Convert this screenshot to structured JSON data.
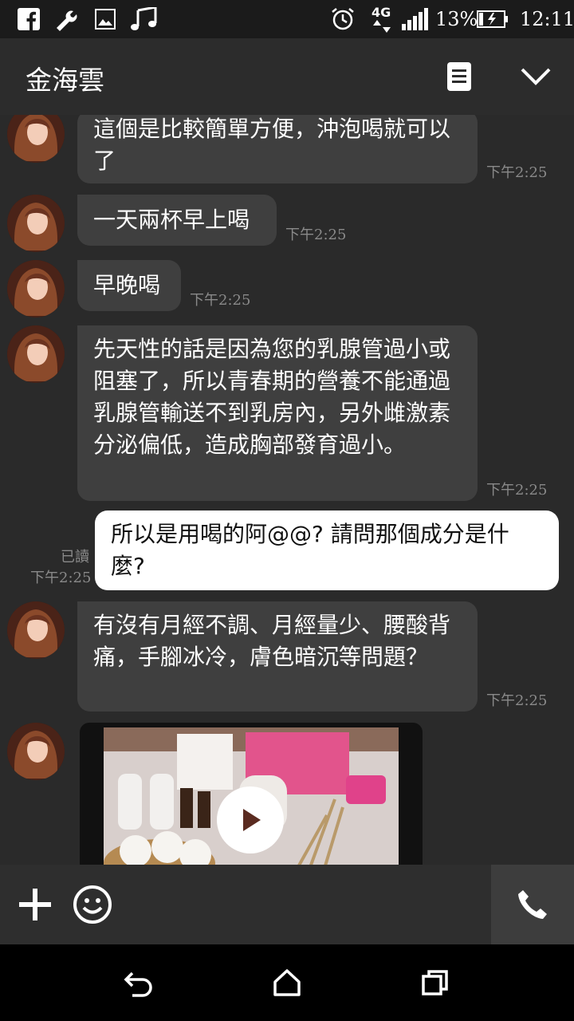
{
  "status_bar": {
    "network": "4G",
    "battery": "13%",
    "time": "12:11",
    "icons": [
      "facebook-icon",
      "wrench-icon",
      "image-icon",
      "music-icon",
      "alarm-icon",
      "signal-icon",
      "battery-icon"
    ]
  },
  "header": {
    "contact_name": "金海雲",
    "menu_icon": "notes-icon",
    "collapse_icon": "chevron-down-icon"
  },
  "messages": [
    {
      "from": "contact",
      "text": "這個是比較簡單方便，沖泡喝就可以了",
      "time": "下午2:25"
    },
    {
      "from": "contact",
      "text": "一天兩杯早上喝",
      "time": "下午2:25"
    },
    {
      "from": "contact",
      "text": "早晚喝",
      "time": "下午2:25"
    },
    {
      "from": "contact",
      "text": "先天性的話是因為您的乳腺管過小或阻塞了，所以青春期的營養不能通過乳腺管輸送不到乳房內，另外雌激素分泌偏低，造成胸部發育過小。",
      "time": "下午2:25"
    },
    {
      "from": "me",
      "text": "所以是用喝的阿@@? 請問那個成分是什麼?",
      "read": "已讀",
      "time": "下午2:25"
    },
    {
      "from": "contact",
      "text": "有沒有月經不調、月經量少、腰酸背痛，手腳冰冷，膚色暗沉等問題？",
      "time": "下午2:25"
    },
    {
      "from": "contact",
      "type": "video",
      "icon": "play-icon"
    }
  ],
  "input_bar": {
    "add_icon": "plus-icon",
    "emoji_icon": "smiley-icon",
    "call_icon": "phone-icon"
  },
  "nav_bar": {
    "icons": [
      "back-icon",
      "home-icon",
      "recents-icon"
    ]
  },
  "colors": {
    "background": "#2a2a2a",
    "incoming_bubble": "#3f3f3f",
    "outgoing_bubble": "#ffffff",
    "timestamp": "#8a8a8a"
  }
}
